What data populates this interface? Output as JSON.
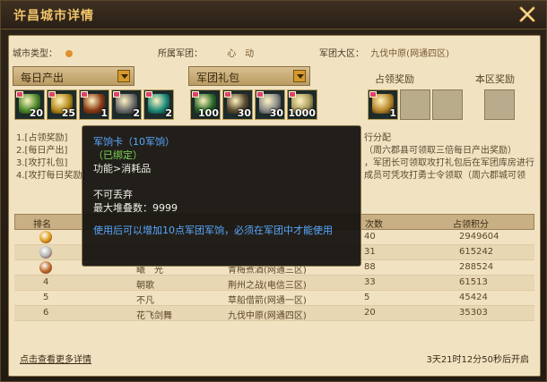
{
  "window": {
    "title": "许昌城市详情"
  },
  "info": {
    "city_type_label": "城市类型：",
    "legion_label": "所属军团：",
    "legion_value": "心　动",
    "region_label": "军团大区：",
    "region_value": "九伐中原(网通四区)"
  },
  "daily": {
    "header": "每日产出",
    "items": [
      {
        "icon": "gold-ingots-icon",
        "count": "20"
      },
      {
        "icon": "coin-bag-icon",
        "count": "25"
      },
      {
        "icon": "treasure-chest-icon",
        "count": "1"
      },
      {
        "icon": "ore-icon",
        "count": "2"
      },
      {
        "icon": "jade-icon",
        "count": "2"
      }
    ]
  },
  "gift": {
    "header": "军团礼包",
    "items": [
      {
        "icon": "herb-icon",
        "count": "100"
      },
      {
        "icon": "horse-icon",
        "count": "30"
      },
      {
        "icon": "cloth-roll-icon",
        "count": "30"
      },
      {
        "icon": "silver-ingot-icon",
        "count": "1000"
      }
    ]
  },
  "occupy": {
    "title": "占领奖励",
    "items": [
      {
        "icon": "legion-shield-icon",
        "count": "1"
      }
    ]
  },
  "region_reward": {
    "title": "本区奖励"
  },
  "rules": [
    "1.[占领奖励]",
    "2.[每日产出]",
    "3.[攻打礼包]",
    "4.[攻打每日奖励]"
  ],
  "rules_visible_right": [
    "行分配",
    "（周六郡县可领取三倍每日产出奖励）",
    "，军团长可领取攻打礼包后在军团库房进行",
    "成员可凭攻打勇士令领取（周六郡城可领"
  ],
  "table": {
    "headers": [
      "排名",
      "",
      "",
      "次数",
      "占领积分"
    ],
    "rows": [
      {
        "rank": "1",
        "medal": "gold",
        "name": "",
        "region": "",
        "times": "40",
        "score": "2949604"
      },
      {
        "rank": "2",
        "medal": "silver",
        "name": "",
        "region": "",
        "times": "31",
        "score": "615242"
      },
      {
        "rank": "3",
        "medal": "bronze",
        "name": "曦　光",
        "region": "青梅煮酒(网通三区)",
        "times": "88",
        "score": "288524"
      },
      {
        "rank": "4",
        "medal": "",
        "name": "朝歌",
        "region": "荆州之战(电信三区)",
        "times": "33",
        "score": "61513"
      },
      {
        "rank": "5",
        "medal": "",
        "name": "不凡",
        "region": "草船借箭(网通一区)",
        "times": "5",
        "score": "45424"
      },
      {
        "rank": "6",
        "medal": "",
        "name": "花飞剑舞",
        "region": "九伐中原(网通四区)",
        "times": "20",
        "score": "35303"
      }
    ]
  },
  "footer": {
    "link": "点击查看更多详情",
    "countdown": "3天21时12分50秒后开启"
  },
  "tooltip": {
    "name": "军饷卡（10军饷）",
    "bound": "（已绑定）",
    "func": "功能>消耗品",
    "discard": "不可丢弃",
    "stack": "最大堆叠数：9999",
    "desc": "使用后可以增加10点军团军饷，必须在军团中才能使用"
  },
  "colors": {
    "title": "#f2c56a",
    "tooltip_name": "#5aa8ff",
    "tooltip_bound": "#7dd857"
  }
}
